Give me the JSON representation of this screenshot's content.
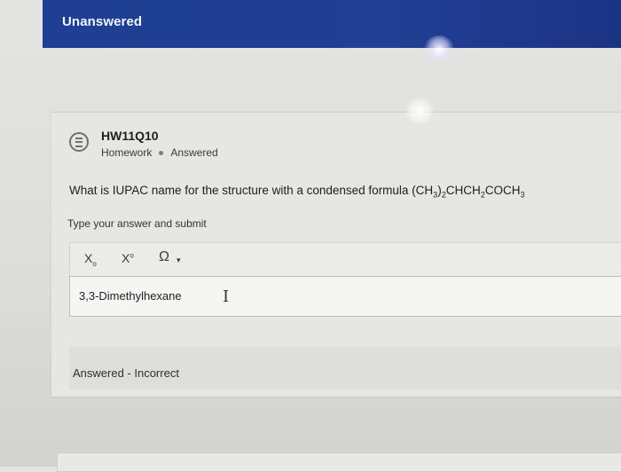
{
  "banner": {
    "title": "Unanswered"
  },
  "question": {
    "icon": "question-list-icon",
    "id": "HW11Q10",
    "type": "Homework",
    "status": "Answered",
    "prompt_text": "What is IUPAC name for the structure with a condensed formula ",
    "formula_parts": [
      {
        "t": "(CH",
        "sub": false
      },
      {
        "t": "3",
        "sub": true
      },
      {
        "t": ")",
        "sub": false
      },
      {
        "t": "2",
        "sub": true
      },
      {
        "t": "CHCH",
        "sub": false
      },
      {
        "t": "2",
        "sub": true
      },
      {
        "t": "COCH",
        "sub": false
      },
      {
        "t": "3",
        "sub": true
      }
    ]
  },
  "answer": {
    "instruction": "Type your answer and submit",
    "toolbar": {
      "subscript_icon": "subscript-icon",
      "superscript_icon": "superscript-icon",
      "special_chars_icon": "omega-icon"
    },
    "value": "3,3-Dimethylhexane",
    "result": "Answered - Incorrect"
  },
  "colors": {
    "banner": "#213f94",
    "card": "#e6e7e4"
  }
}
